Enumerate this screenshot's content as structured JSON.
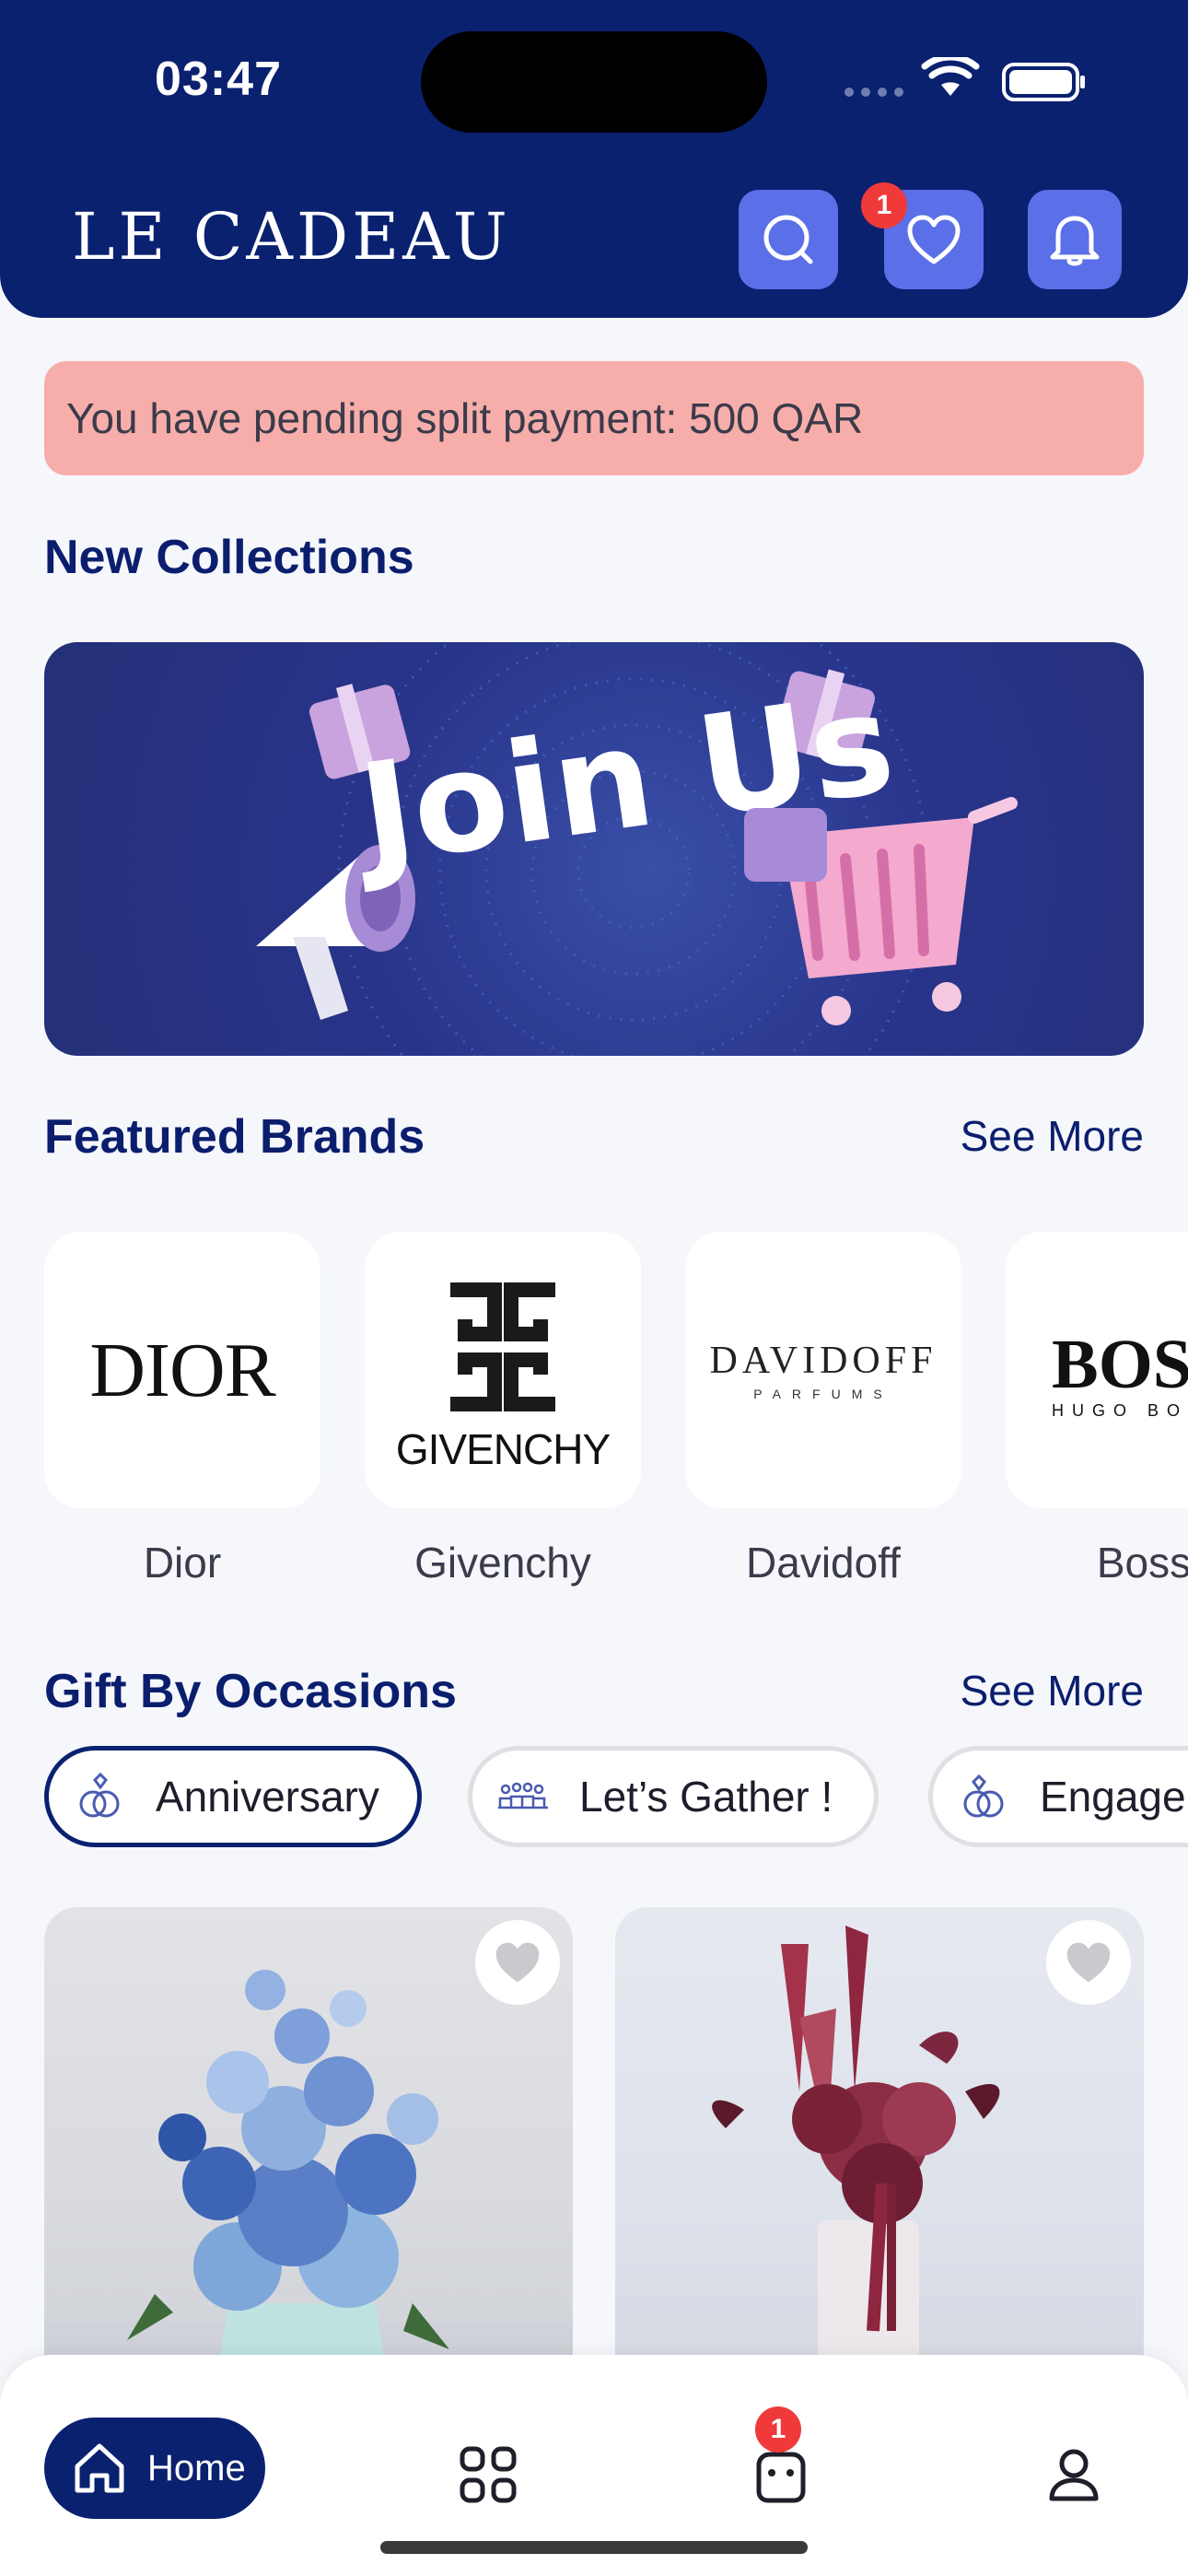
{
  "status_bar": {
    "time": "03:47"
  },
  "header": {
    "logo": "LE CADEAU",
    "wishlist_badge": "1"
  },
  "pending_banner": {
    "text": "You have pending split payment: 500 QAR"
  },
  "new_collections": {
    "title": "New Collections",
    "promo_text": "Join Us"
  },
  "featured_brands": {
    "title": "Featured Brands",
    "see_more": "See More",
    "items": [
      {
        "logo": "DIOR",
        "name": "Dior"
      },
      {
        "logo": "GIVENCHY",
        "name": "Givenchy"
      },
      {
        "logo": "DAVIDOFF",
        "logo_sub": "PARFUMS",
        "name": "Davidoff"
      },
      {
        "logo": "BOSS",
        "logo_sub": "HUGO BOSS",
        "name": "Boss"
      }
    ]
  },
  "gift_by_occasions": {
    "title": "Gift By Occasions",
    "see_more": "See More",
    "chips": [
      {
        "label": "Anniversary",
        "active": true
      },
      {
        "label": "Let’s Gather !",
        "active": false
      },
      {
        "label": "Engagement",
        "active": false
      }
    ]
  },
  "products": [
    {
      "image": "blue-flower-arrangement"
    },
    {
      "image": "burgundy-flower-arrangement"
    }
  ],
  "tabbar": {
    "home_label": "Home",
    "cart_badge": "1"
  },
  "colors": {
    "primary": "#0A2170",
    "accent_button": "#5A6FE8",
    "badge": "#F03A3A",
    "banner": "#F7AEAB",
    "background": "#F5F7FB"
  }
}
